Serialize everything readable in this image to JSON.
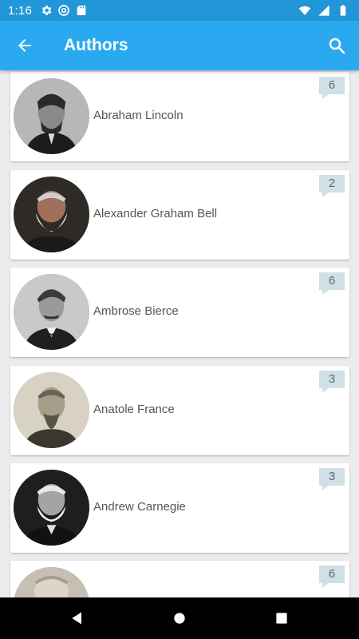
{
  "status_bar": {
    "time": "1:16"
  },
  "app_bar": {
    "title": "Authors"
  },
  "authors": [
    {
      "name": "Abraham Lincoln",
      "count": "6"
    },
    {
      "name": "Alexander Graham Bell",
      "count": "2"
    },
    {
      "name": "Ambrose Bierce",
      "count": "6"
    },
    {
      "name": "Anatole France",
      "count": "3"
    },
    {
      "name": "Andrew Carnegie",
      "count": "3"
    },
    {
      "name": "",
      "count": "6"
    }
  ],
  "colors": {
    "status_bar": "#2196d9",
    "app_bar": "#2aa8f0",
    "badge": "#cfe0e6",
    "card": "#ffffff",
    "background": "#ececec"
  },
  "icons": [
    "settings-icon",
    "at-sign-icon",
    "sd-card-icon",
    "wifi-icon",
    "signal-icon",
    "battery-icon",
    "back-arrow-icon",
    "search-icon",
    "nav-back-icon",
    "nav-home-icon",
    "nav-recents-icon"
  ]
}
